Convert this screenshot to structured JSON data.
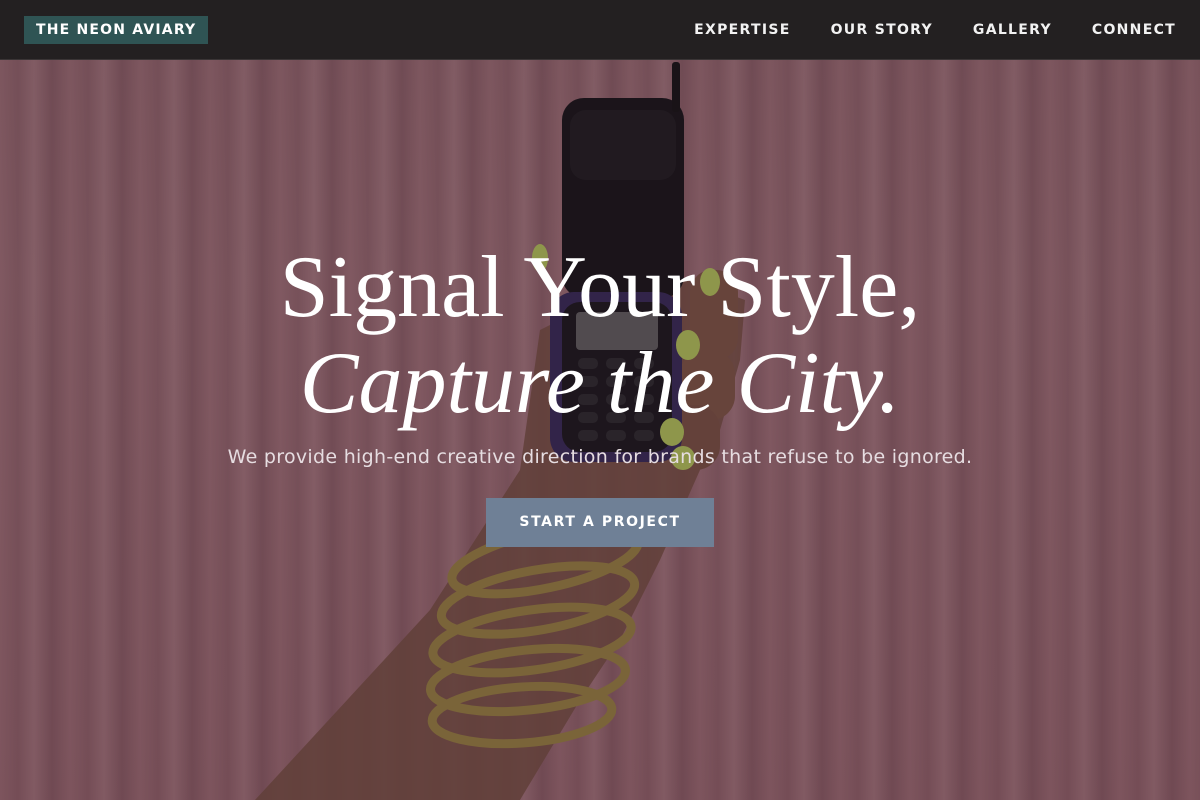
{
  "brand": {
    "name": "THE NEON AVIARY",
    "bg_color": "#2f5454"
  },
  "nav": {
    "items": [
      {
        "label": "EXPERTISE"
      },
      {
        "label": "OUR STORY"
      },
      {
        "label": "GALLERY"
      },
      {
        "label": "CONNECT"
      }
    ]
  },
  "hero": {
    "headline_line1": "Signal Your Style,",
    "headline_line2": "Capture the City.",
    "subheading": "We provide high-end creative direction for brands that refuse to be ignored.",
    "cta_label": "START A PROJECT",
    "cta_color": "#6f8096",
    "background_image": "hand-holding-flip-phone-photo"
  }
}
